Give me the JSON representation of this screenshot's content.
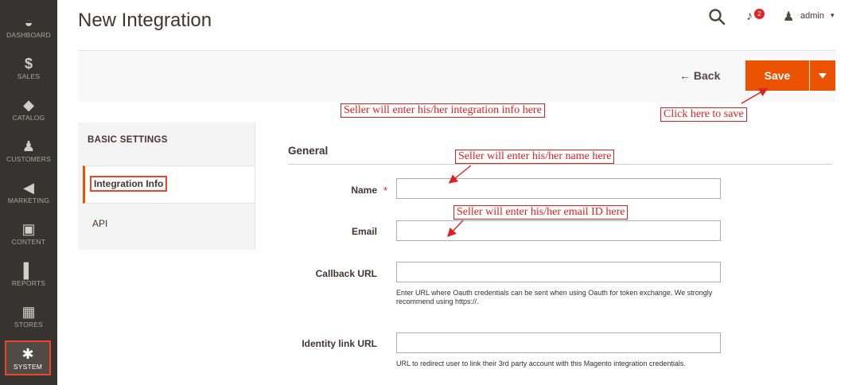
{
  "sidebar": {
    "items": [
      {
        "label": "DASHBOARD",
        "icon": "dashboard-icon",
        "glyph": "◒"
      },
      {
        "label": "SALES",
        "icon": "dollar-icon",
        "glyph": "$"
      },
      {
        "label": "CATALOG",
        "icon": "cube-icon",
        "glyph": "◆"
      },
      {
        "label": "CUSTOMERS",
        "icon": "person-icon",
        "glyph": "♟"
      },
      {
        "label": "MARKETING",
        "icon": "megaphone-icon",
        "glyph": "◀"
      },
      {
        "label": "CONTENT",
        "icon": "layout-icon",
        "glyph": "▣"
      },
      {
        "label": "REPORTS",
        "icon": "bar-chart-icon",
        "glyph": "▌"
      },
      {
        "label": "STORES",
        "icon": "store-icon",
        "glyph": "▦"
      },
      {
        "label": "SYSTEM",
        "icon": "gear-icon",
        "glyph": "✱"
      }
    ]
  },
  "header": {
    "title": "New Integration",
    "notification_count": "2",
    "user": "admin",
    "user_glyph": "♟",
    "bell_glyph": "♪",
    "caret": "▾"
  },
  "actions": {
    "back_label": "← Back",
    "save_label": "Save"
  },
  "tabs": {
    "title": "BASIC SETTINGS",
    "items": [
      "Integration Info",
      "API"
    ]
  },
  "form": {
    "section_title": "General",
    "fields": [
      {
        "label": "Name",
        "required": "*",
        "value": ""
      },
      {
        "label": "Email",
        "value": ""
      },
      {
        "label": "Callback URL",
        "value": "",
        "note": "Enter URL where Oauth credentials can be sent when using Oauth for token exchange. We strongly recommend using https://."
      },
      {
        "label": "Identity link URL",
        "value": "",
        "note": "URL to redirect user to link their 3rd party account with this Magento integration credentials."
      }
    ]
  },
  "annotations": {
    "integration_info": "Seller will enter his/her integration info here",
    "save": "Click here to save",
    "name": "Seller will enter his/her name here",
    "email": "Seller will enter his/her email ID here"
  },
  "colors": {
    "accent": "#eb5202",
    "annotation": "#e02020",
    "sidebar": "#373330"
  }
}
